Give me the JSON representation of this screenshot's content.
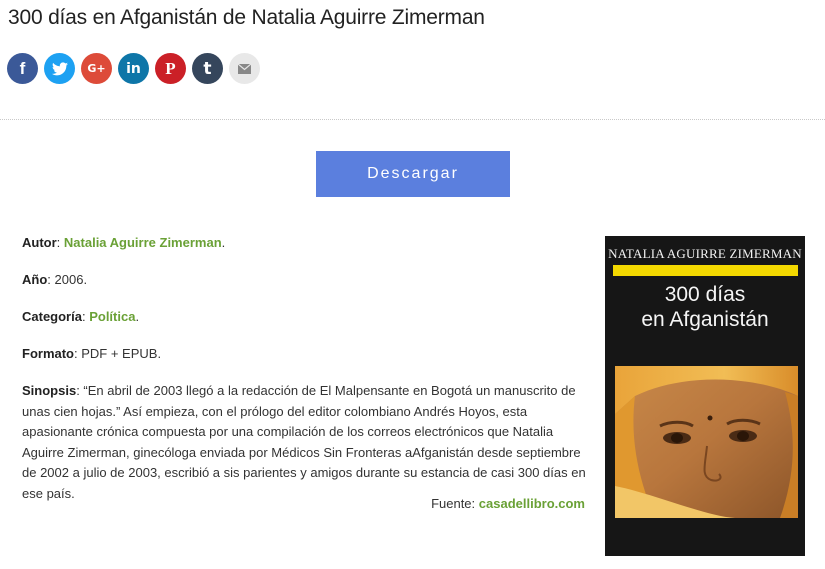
{
  "title": "300 días en Afganistán de Natalia Aguirre Zimerman",
  "share": {
    "facebook": "f",
    "google": "G+",
    "linkedin": "in",
    "pinterest": "P",
    "tumblr": "t",
    "colors": {
      "facebook": "#3b5998",
      "twitter": "#1da1f2",
      "google": "#dd4b39",
      "linkedin": "#0e76a8",
      "pinterest": "#cb2027",
      "tumblr": "#35465c",
      "email": "#e8e8e8"
    }
  },
  "download": {
    "label": "Descargar",
    "color": "#5b7fde"
  },
  "details": {
    "author_label": "Autor",
    "author_value": "Natalia Aguirre Zimerman",
    "year_label": "Año",
    "year_value": "2006",
    "category_label": "Categoría",
    "category_value": "Política",
    "format_label": "Formato",
    "format_value": "PDF + EPUB",
    "synopsis_label": "Sinopsis",
    "synopsis_value": "“En abril de 2003 llegó a la redacción de El Malpensante en Bogotá un manuscrito de unas cien hojas.” Así empieza, con el prólogo del editor colombiano Andrés Hoyos, esta apasionante crónica compuesta por una compilación de los correos electrónicos que Natalia Aguirre Zimerman, ginecóloga enviada por Médicos Sin Fronteras aAfganistán desde septiembre de 2002 a julio de 2003, escribió a sis parientes y amigos durante su estancia de casi 300 días en ese país.",
    "link_color": "#6aa136"
  },
  "source": {
    "label": "Fuente:",
    "value": "casadellibro.com"
  },
  "cover": {
    "author": "NATALIA AGUIRRE ZIMERMAN",
    "title_line1": "300 días",
    "title_line2": "en Afganistán",
    "background": "#161616",
    "bar_color": "#f3d800"
  }
}
